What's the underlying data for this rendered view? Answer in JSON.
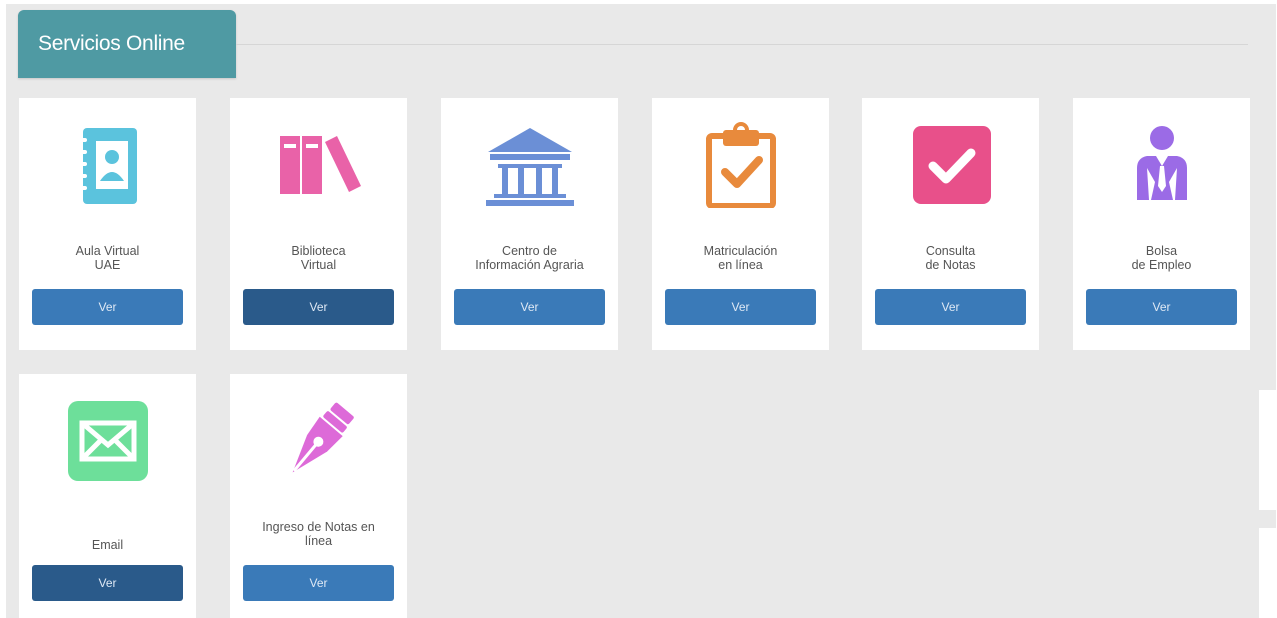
{
  "header": {
    "title": "Servicios Online"
  },
  "cards": [
    {
      "line1": "Aula Virtual",
      "line2": "UAE",
      "button": "Ver",
      "icon": "contact-book-icon"
    },
    {
      "line1": "Biblioteca",
      "line2": "Virtual",
      "button": "Ver",
      "icon": "books-icon"
    },
    {
      "line1": "Centro de",
      "line2": "Información Agraria",
      "button": "Ver",
      "icon": "institution-icon"
    },
    {
      "line1": "Matriculación",
      "line2": "en línea",
      "button": "Ver",
      "icon": "clipboard-check-icon"
    },
    {
      "line1": "Consulta",
      "line2": "de Notas",
      "button": "Ver",
      "icon": "checkbox-icon"
    },
    {
      "line1": "Bolsa",
      "line2": "de Empleo",
      "button": "Ver",
      "icon": "employee-icon"
    },
    {
      "line1": "Email",
      "line2": "",
      "button": "Ver",
      "icon": "envelope-icon"
    },
    {
      "line1": "Ingreso de Notas en",
      "line2": "línea",
      "button": "Ver",
      "icon": "pen-nib-icon"
    }
  ],
  "colors": {
    "header": "#4f9aa3",
    "button": "#3a7ab8",
    "button_active": "#2a5a8a",
    "aula_icon": "#5bc3dd",
    "biblioteca_icon": "#e962a8",
    "centro_icon": "#6b8fd6",
    "matricula_icon": "#e88a3c",
    "notas_icon": "#e8508a",
    "empleo_icon": "#9b6be6",
    "email_icon": "#6ddf9a",
    "ingreso_icon": "#dd6ad8"
  }
}
